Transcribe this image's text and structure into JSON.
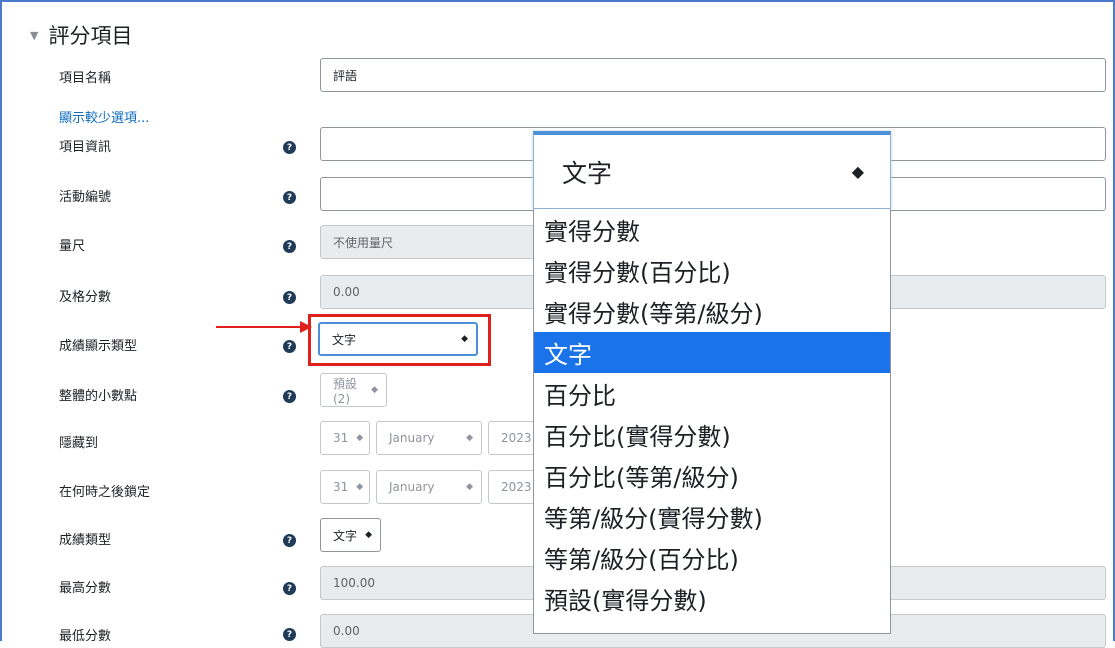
{
  "section": {
    "title": "評分項目"
  },
  "fields": {
    "item_name": {
      "label": "項目名稱",
      "value": "評語"
    },
    "show_less": "顯示較少選項...",
    "item_info": {
      "label": "項目資訊",
      "value": ""
    },
    "activity_id": {
      "label": "活動編號",
      "value": ""
    },
    "scale": {
      "label": "量尺",
      "value": "不使用量尺"
    },
    "pass_grade": {
      "label": "及格分數",
      "value": "0.00"
    },
    "display_type": {
      "label": "成績顯示類型",
      "value": "文字"
    },
    "decimals": {
      "label": "整體的小數點",
      "value": "預設(2)"
    },
    "hidden_until": {
      "label": "隱藏到",
      "day": "31",
      "month": "January",
      "year": "2023"
    },
    "locked_after": {
      "label": "在何時之後鎖定",
      "day": "31",
      "month": "January",
      "year": "2023"
    },
    "grade_type": {
      "label": "成績類型",
      "value": "文字"
    },
    "max_grade": {
      "label": "最高分數",
      "value": "100.00"
    },
    "min_grade": {
      "label": "最低分數",
      "value": "0.00"
    }
  },
  "dropdown": {
    "selected_value": "文字",
    "options": [
      "實得分數",
      "實得分數(百分比)",
      "實得分數(等第/級分)",
      "文字",
      "百分比",
      "百分比(實得分數)",
      "百分比(等第/級分)",
      "等第/級分(實得分數)",
      "等第/級分(百分比)",
      "預設(實得分數)"
    ],
    "selected_index": 3
  },
  "colors": {
    "accent": "#1a73e8",
    "highlight_box": "#e0201a",
    "help_icon": "#1f3b57",
    "link": "#0f6cbf"
  }
}
